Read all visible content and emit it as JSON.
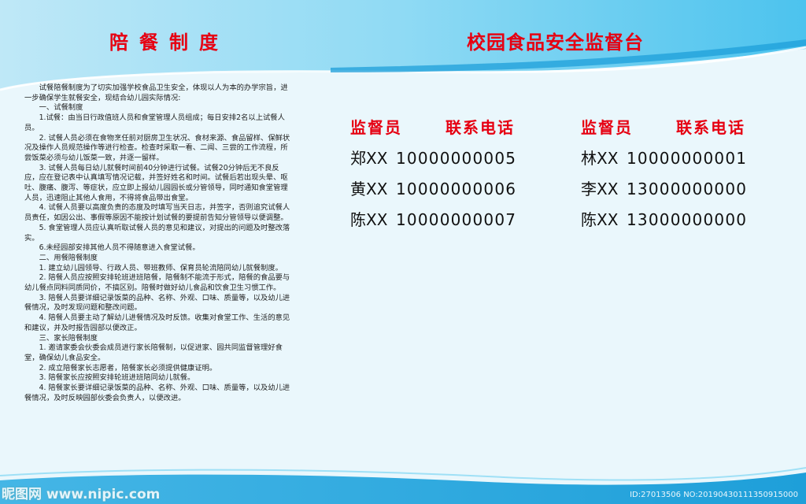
{
  "header": {
    "left_title": "陪餐制度",
    "right_title": "校园食品安全监督台"
  },
  "rules": {
    "paragraphs": [
      {
        "text": "试餐陪餐制度为了切实加强学校食品卫生安全，体现以人为本的办学宗旨，进一步确保学生就餐安全，现结合幼儿园实际情况:",
        "indent": true
      },
      {
        "text": "一、试餐制度",
        "indent": true
      },
      {
        "text": "1.试餐：由当日行政值班人员和食堂管理人员组成；每日安排2名以上试餐人员。",
        "indent": true
      },
      {
        "text": "2. 试餐人员必须在食物烹任前对厨房卫生状况、食材来源、食品留样、保鲜状况及操作人员规范操作等进行检查。检查时采取一看、二闻、三尝的工作流程，所尝饭菜必须与幼儿饭菜一致，并逐一留样。",
        "indent": true
      },
      {
        "text": "3. 试餐人员每日幼儿就餐时间前40分钟进行试餐。试餐20分钟后无不良反应，应在登记表中认真填写情况记载，并签好姓名和时间。试餐后若出现头晕、呕吐、腹痛、腹泻、等症状，应立即上报幼儿园园长或分管领导，同时通知食堂管理人员，迅速阻止其他人食用，不得将食品带出食堂。",
        "indent": true
      },
      {
        "text": "4. 试餐人员要以高度负责的态度及时填写当天日志，并签字，否则追究试餐人员责任，如因公出、事假等原因不能按计划试餐的要提前告知分管领导以便调整。",
        "indent": true
      },
      {
        "text": "5. 食堂管理人员应认真听取试餐人员的意见和建议，对提出的问题及时整改落实。",
        "indent": true
      },
      {
        "text": "6.未经园部安排其他人员不得随意进入食堂试餐。",
        "indent": true
      },
      {
        "text": "二、用餐陪餐制度",
        "indent": true
      },
      {
        "text": "1. 建立幼儿园领导、行政人员、带班教师、保育员轮流陪同幼儿就餐制度。",
        "indent": true
      },
      {
        "text": "2. 陪餐人员应按照安排轮班进班陪餐，陪餐制不能流于形式，陪餐的食品要与幼儿餐点同料同质同价，不搞区别。陪餐时做好幼儿食品和饮食卫生习惯工作。",
        "indent": true
      },
      {
        "text": "3. 陪餐人员要详细记录饭菜的品种、名称、外观、口味、质量等，以及幼儿进餐情况，及时发现问题和整改问题。",
        "indent": true
      },
      {
        "text": "4. 陪餐人员要主动了解幼儿进餐情况及时反馈。收集对食堂工作、生活的意见和建议，并及时报告园部以便改正。",
        "indent": true
      },
      {
        "text": "三、家长陪餐制度",
        "indent": true
      },
      {
        "text": "1. 邀请家委会伙委会成员进行家长陪餐制，以促进家、园共同监督管理好食堂，确保幼儿食品安全。",
        "indent": true
      },
      {
        "text": "2. 成立陪餐家长志愿者，陪餐家长必须提供健康证明。",
        "indent": true
      },
      {
        "text": "3. 陪餐家长应按照安排轮班进班陪同幼儿就餐。",
        "indent": true
      },
      {
        "text": "4. 陪餐家长要详细记录饭菜的品种、名称、外观、口味、质量等，以及幼儿进餐情况，及时反映园部伙委会负责人，以便改进。",
        "indent": true
      }
    ]
  },
  "supervision": {
    "header_name": "监督员",
    "header_phone": "联系电话",
    "left": [
      {
        "name": "郑XX",
        "phone": "10000000005"
      },
      {
        "name": "黄XX",
        "phone": "10000000006"
      },
      {
        "name": "陈XX",
        "phone": "10000000007"
      }
    ],
    "right": [
      {
        "name": "林XX",
        "phone": "10000000001"
      },
      {
        "name": "李XX",
        "phone": "13000000000"
      },
      {
        "name": "陈XX",
        "phone": "13000000000"
      }
    ]
  },
  "watermark": {
    "left": "昵图网 www.nipic.com",
    "right": "ID:27013506 NO:20190430111350915000"
  },
  "colors": {
    "accent_red": "#e60012",
    "wave_blue": "#2ab0e4",
    "light_blue": "#7fd3f2",
    "background": "#e9f6fb"
  }
}
